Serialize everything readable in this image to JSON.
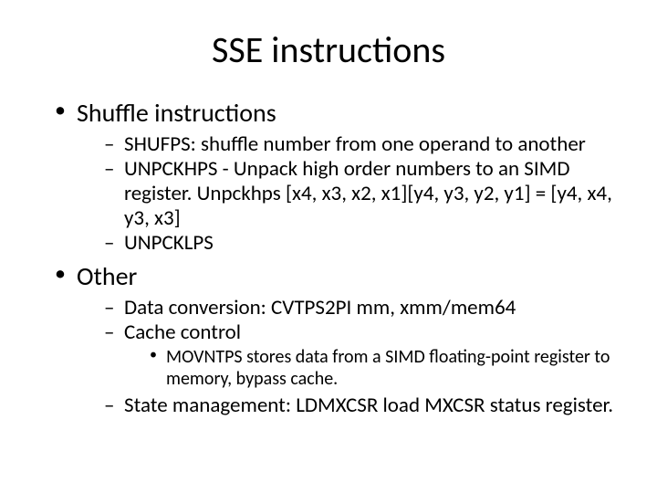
{
  "title": "SSE instructions",
  "bullets": {
    "b1": "Shuffle instructions",
    "b1_1": "SHUFPS: shuffle number from one operand to another",
    "b1_2": "UNPCKHPS - Unpack high order numbers to an SIMD register.  Unpckhps [x4, x3, x2, x1][y4, y3, y2, y1] = [y4, x4, y3, x3]",
    "b1_3": "UNPCKLPS",
    "b2": "Other",
    "b2_1": "Data conversion: CVTPS2PI mm, xmm/mem64",
    "b2_2": "Cache control",
    "b2_2_1": "MOVNTPS stores data from a SIMD floating-point register to memory, bypass cache.",
    "b2_3": "State management: LDMXCSR load MXCSR status register."
  }
}
